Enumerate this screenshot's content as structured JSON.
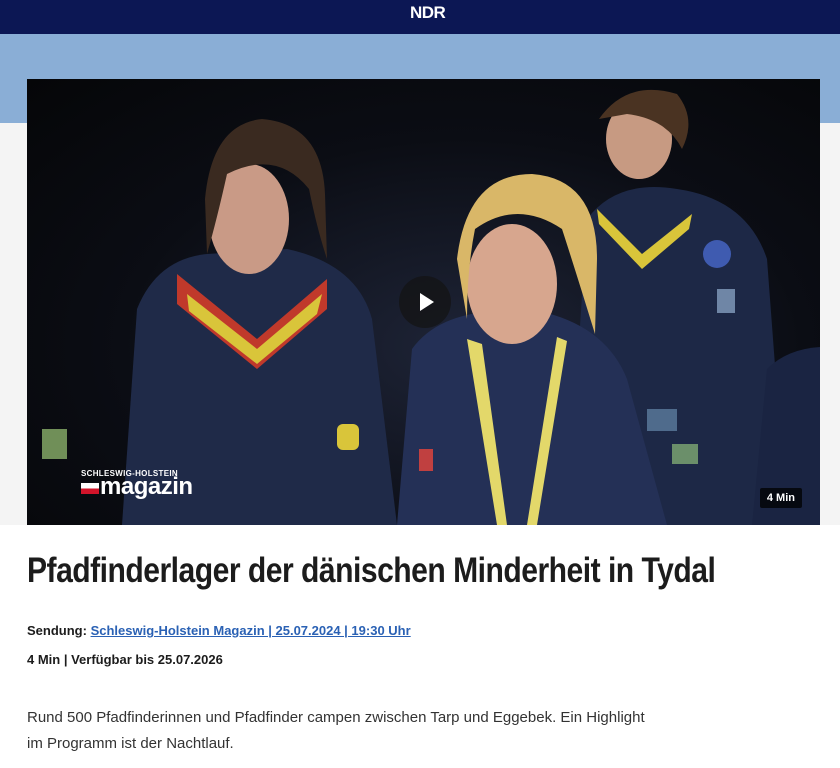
{
  "header": {
    "logo": "NDR"
  },
  "video": {
    "brand_top": "SCHLESWIG-HOLSTEIN",
    "brand_name": "magazin",
    "duration": "4 Min"
  },
  "article": {
    "title": "Pfadfinderlager der dänischen Minderheit in Tydal",
    "sendung_label": "Sendung:",
    "sendung_link": "Schleswig-Holstein Magazin | 25.07.2024 | 19:30 Uhr",
    "info": "4 Min | Verfügbar bis 25.07.2026",
    "teaser_line1": "Rund 500 Pfadfinderinnen und Pfadfinder campen zwischen Tarp und Eggebek. Ein Highlight",
    "teaser_line2": "im Programm ist der Nachtlauf."
  }
}
